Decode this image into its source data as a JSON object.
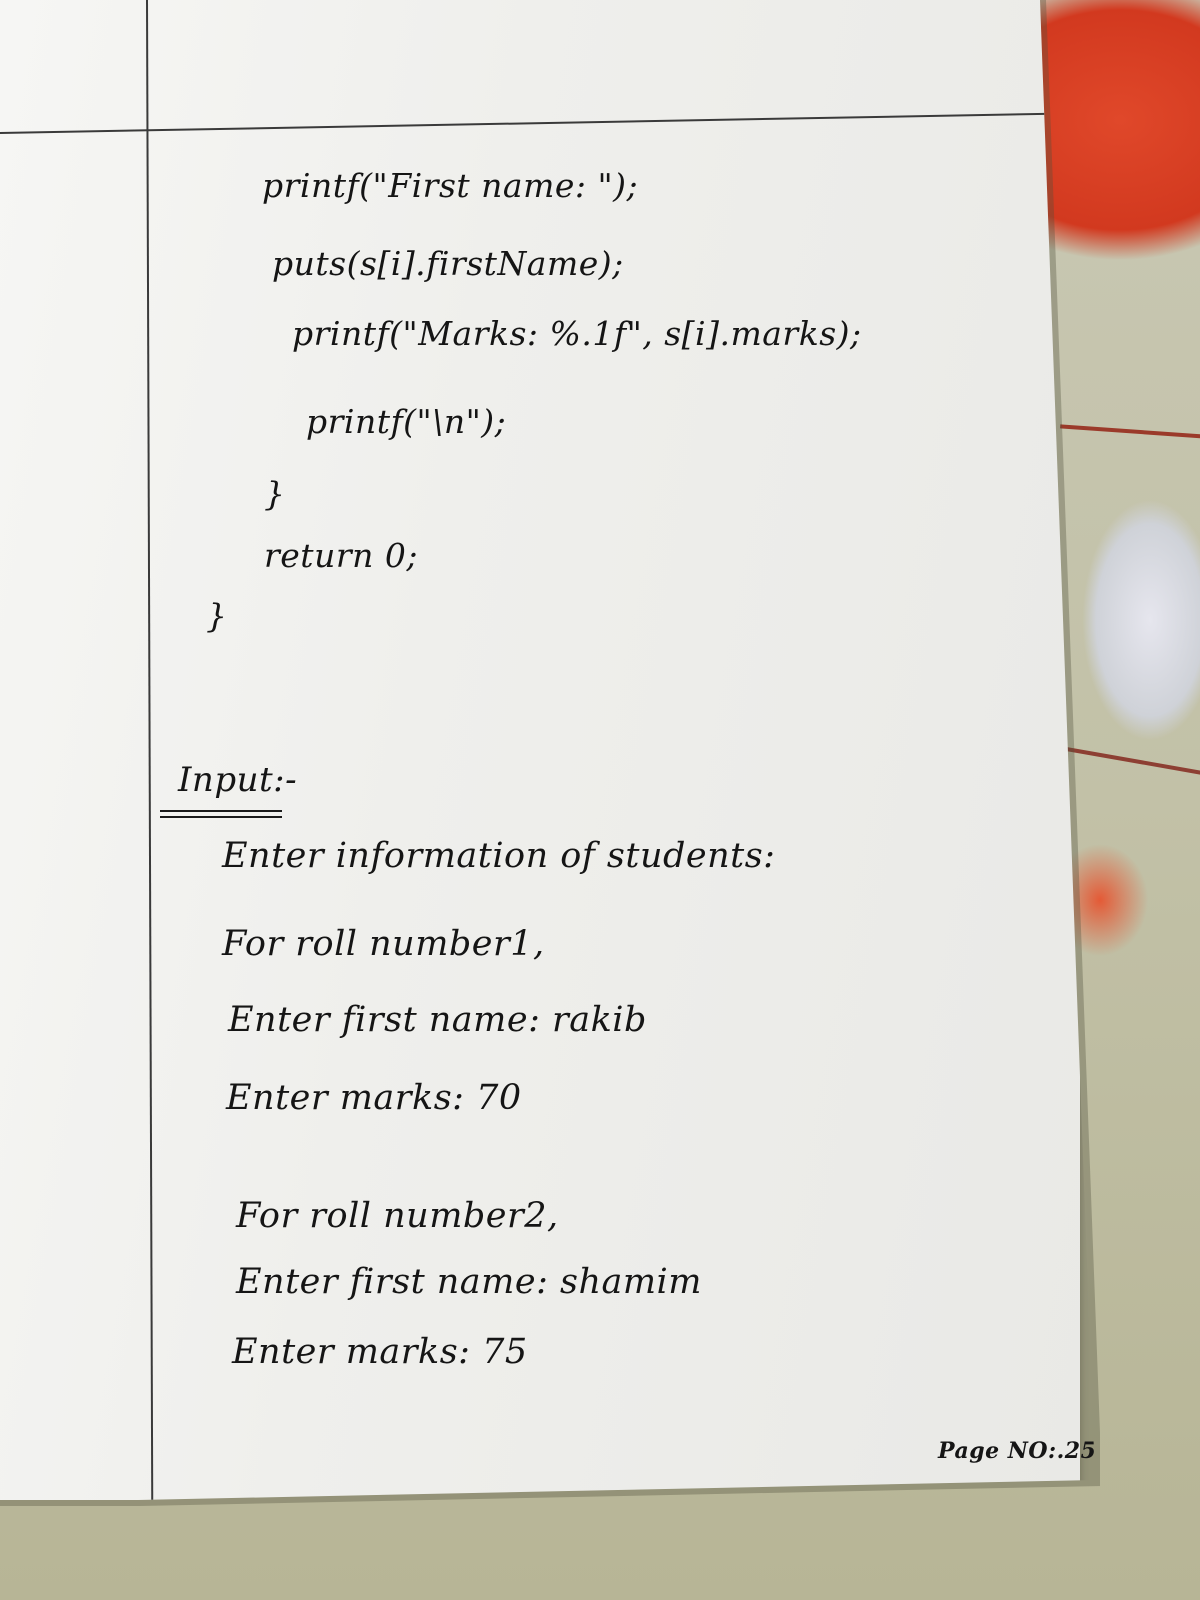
{
  "code": {
    "line1": "printf(\"First name: \");",
    "line2": "puts(s[i].firstName);",
    "line3": "printf(\"Marks: %.1f\", s[i].marks);",
    "line4": "printf(\"\\n\");",
    "line5": "}",
    "line6": "return 0;",
    "line7": "}"
  },
  "input_section": {
    "heading": "Input:-",
    "intro": "Enter information of students:",
    "students": [
      {
        "roll": "For roll number1,",
        "first_name": "Enter first name: rakib",
        "marks": "Enter marks: 70"
      },
      {
        "roll": "For roll number2,",
        "first_name": "Enter first name: shamim",
        "marks": "Enter marks: 75"
      }
    ]
  },
  "footer": {
    "page_number": "Page NO:.25"
  }
}
